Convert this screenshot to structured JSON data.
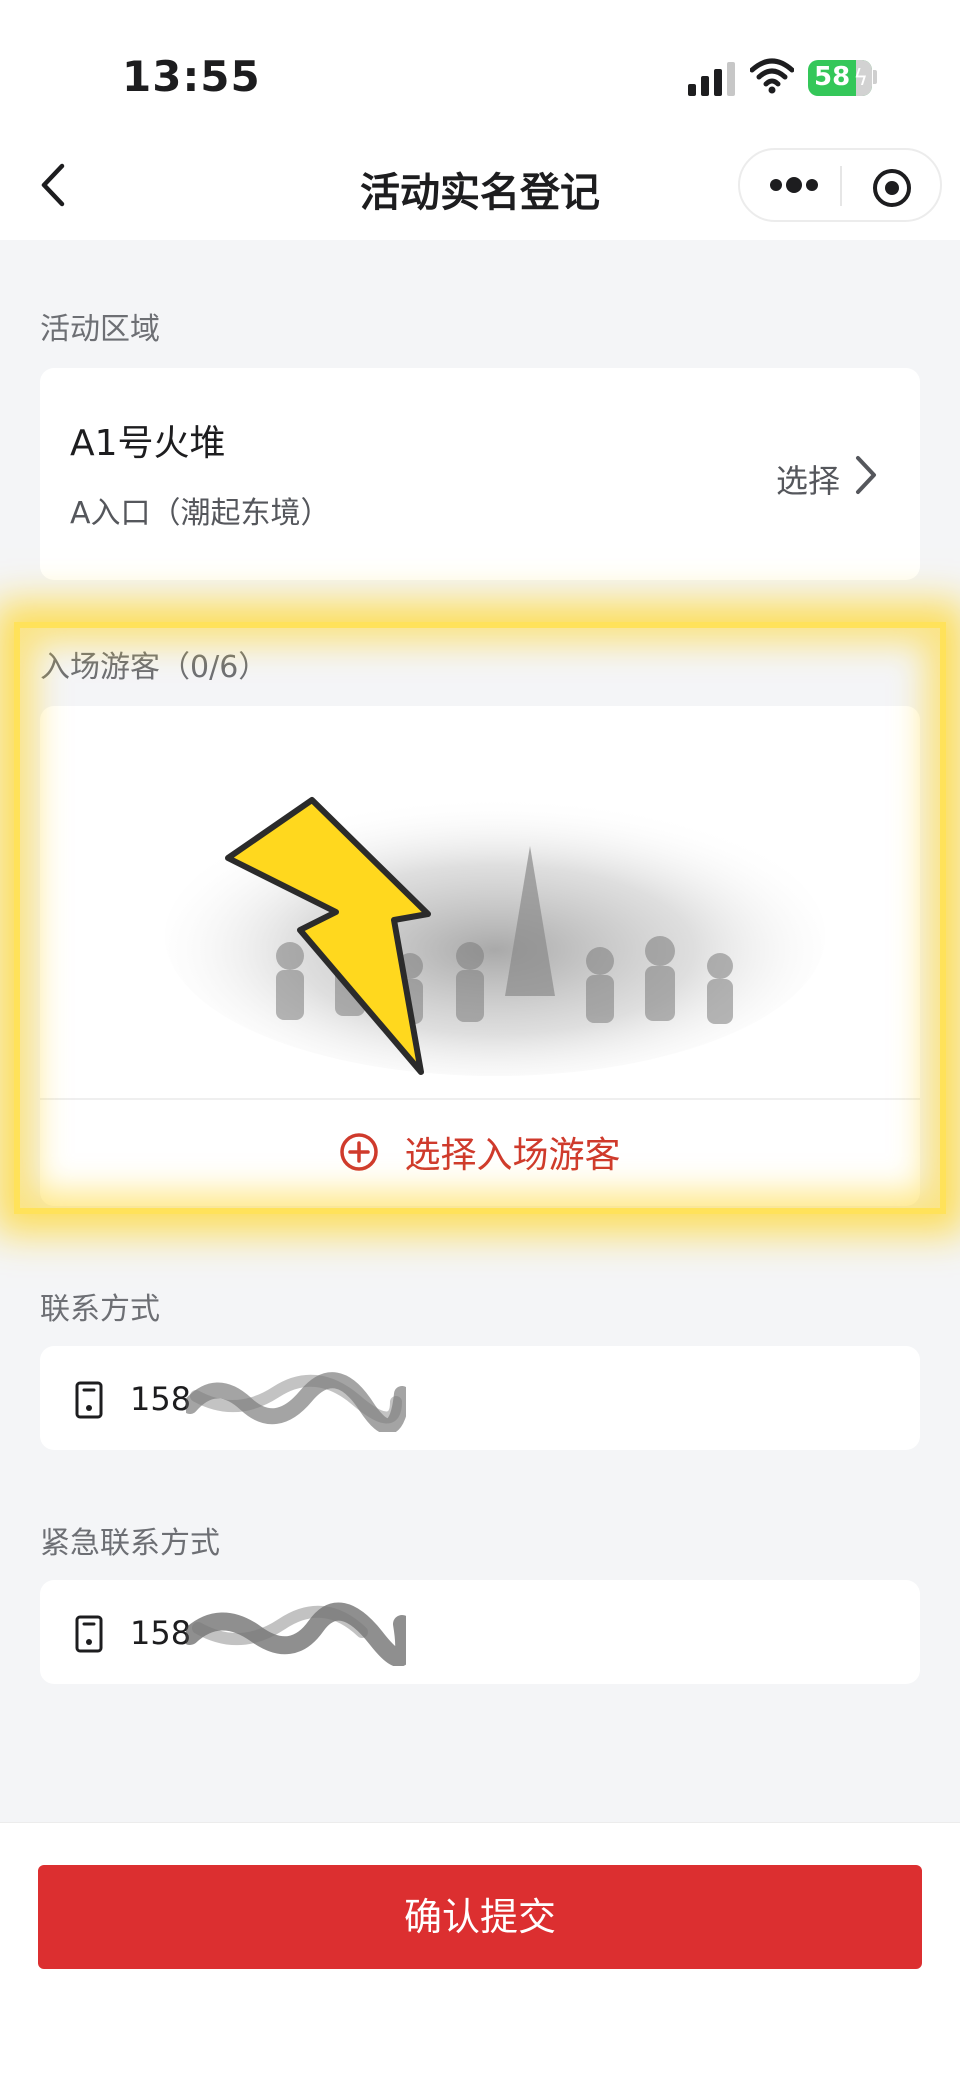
{
  "status_bar": {
    "time": "13:55",
    "battery": "58"
  },
  "nav": {
    "title": "活动实名登记"
  },
  "area_section": {
    "label": "活动区域",
    "name": "A1号火堆",
    "entrance": "A入口（潮起东境）",
    "choose_label": "选择"
  },
  "visitors_section": {
    "label": "入场游客（0/6）",
    "add_label": "选择入场游客"
  },
  "contact_section": {
    "label": "联系方式",
    "phone": "158"
  },
  "emergency_section": {
    "label": "紧急联系方式",
    "phone": "158"
  },
  "submit": {
    "label": "确认提交"
  },
  "colors": {
    "accent": "#dc2f30",
    "highlight": "#ffd428",
    "battery": "#34c759"
  }
}
